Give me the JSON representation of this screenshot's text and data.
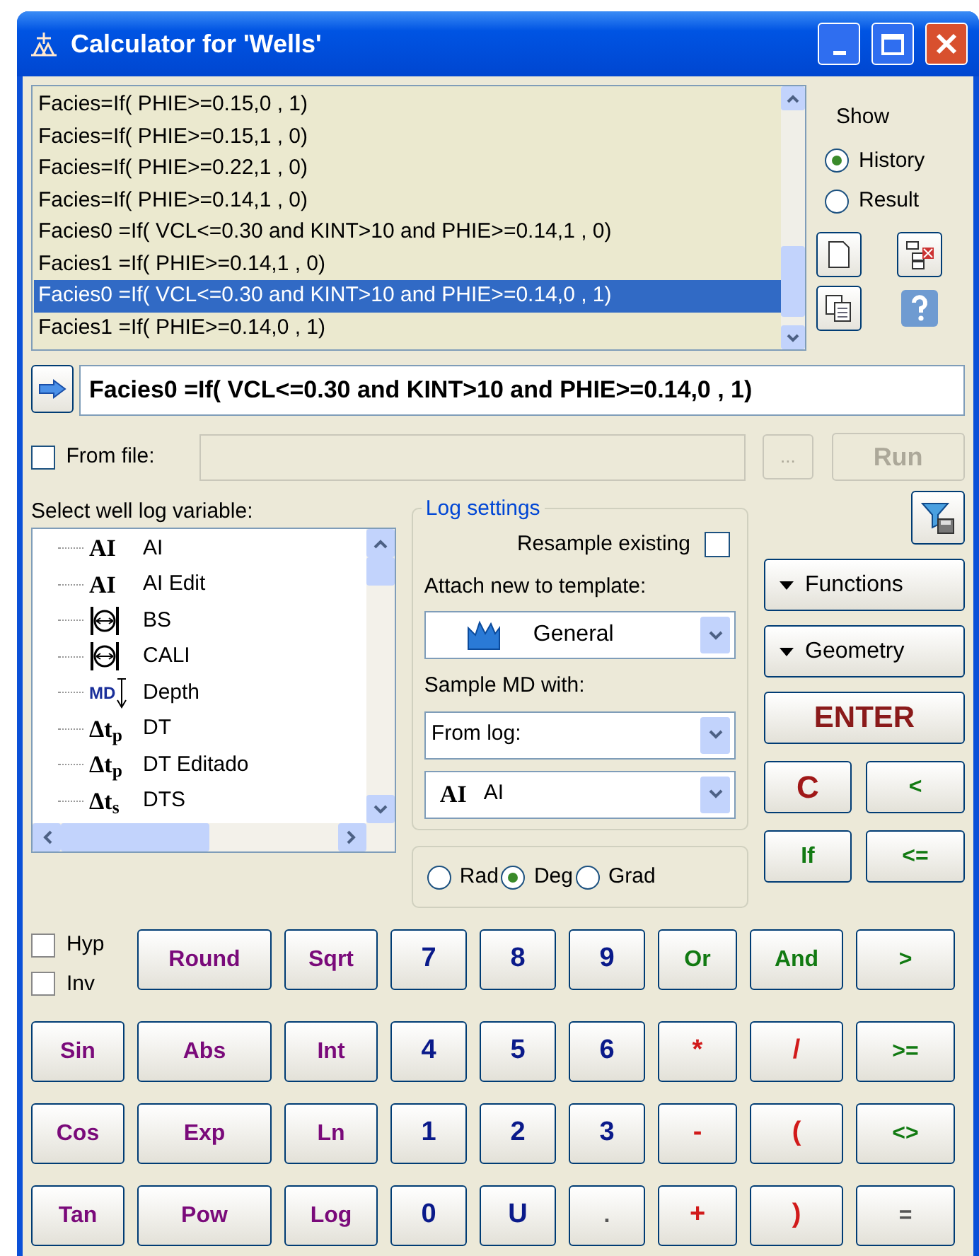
{
  "window": {
    "title": "Calculator for 'Wells'"
  },
  "history": [
    {
      "text": "Facies=If( PHIE>=0.15,0 , 1)",
      "selected": false
    },
    {
      "text": "Facies=If( PHIE>=0.15,1 , 0)",
      "selected": false
    },
    {
      "text": "Facies=If( PHIE>=0.22,1 , 0)",
      "selected": false
    },
    {
      "text": "Facies=If( PHIE>=0.14,1 , 0)",
      "selected": false
    },
    {
      "text": "Facies0 =If( VCL<=0.30 and KINT>10 and PHIE>=0.14,1 , 0)",
      "selected": false
    },
    {
      "text": "Facies1 =If( PHIE>=0.14,1 , 0)",
      "selected": false
    },
    {
      "text": "Facies0 =If( VCL<=0.30 and KINT>10 and PHIE>=0.14,0 , 1)",
      "selected": true
    },
    {
      "text": "Facies1 =If( PHIE>=0.14,0 , 1)",
      "selected": false
    }
  ],
  "show": {
    "label": "Show",
    "options": [
      {
        "label": "History",
        "selected": true
      },
      {
        "label": "Result",
        "selected": false
      }
    ]
  },
  "formula": {
    "value": "Facies0 =If( VCL<=0.30 and KINT>10 and PHIE>=0.14,0 , 1)"
  },
  "from_file": {
    "label": "From file:",
    "checked": false,
    "browse": "...",
    "run": "Run",
    "run_disabled": true
  },
  "variables": {
    "label": "Select well log variable:",
    "items": [
      {
        "kind": "text",
        "symbol": "AI",
        "name": "AI"
      },
      {
        "kind": "text",
        "symbol": "AI",
        "name": "AI Edit"
      },
      {
        "kind": "caliper",
        "name": "BS"
      },
      {
        "kind": "caliper",
        "name": "CALI"
      },
      {
        "kind": "depth",
        "symbol": "MD",
        "name": "Depth"
      },
      {
        "kind": "text",
        "symbol": "Δt$_{p}$",
        "name": "DT"
      },
      {
        "kind": "text",
        "symbol": "Δt$_{p}$",
        "name": "DT Editado"
      },
      {
        "kind": "text",
        "symbol": "Δt$_{s}$",
        "name": "DTS"
      }
    ]
  },
  "log_settings": {
    "title": "Log settings",
    "resample": {
      "label": "Resample existing",
      "checked": false
    },
    "attach_label": "Attach new to template:",
    "template": "General",
    "sample_label": "Sample MD with:",
    "sample_with": "From log:",
    "log": {
      "symbol": "AI",
      "value": "AI"
    }
  },
  "angle_units": [
    {
      "label": "Rad",
      "selected": false
    },
    {
      "label": "Deg",
      "selected": true
    },
    {
      "label": "Grad",
      "selected": false
    }
  ],
  "side_buttons": [
    {
      "label": "Functions",
      "kind": "menu"
    },
    {
      "label": "Geometry",
      "kind": "menu"
    },
    {
      "label": "ENTER",
      "kind": "enter"
    }
  ],
  "side_pairs": [
    [
      {
        "label": "C",
        "kind": "clear"
      },
      {
        "label": "<",
        "kind": "logic"
      }
    ],
    [
      {
        "label": "If",
        "kind": "logic"
      },
      {
        "label": "<=",
        "kind": "logic"
      }
    ]
  ],
  "modifiers": [
    {
      "label": "Hyp",
      "checked": false
    },
    {
      "label": "Inv",
      "checked": false
    }
  ],
  "keypad": [
    [
      {
        "label": "Round",
        "kind": "function"
      },
      {
        "label": "Sqrt",
        "kind": "function"
      },
      {
        "label": "7",
        "kind": "digit"
      },
      {
        "label": "8",
        "kind": "digit"
      },
      {
        "label": "9",
        "kind": "digit"
      },
      {
        "label": "Or",
        "kind": "logic"
      },
      {
        "label": "And",
        "kind": "logic"
      },
      {
        "label": ">",
        "kind": "logic"
      }
    ],
    [
      {
        "label": "Sin",
        "kind": "function"
      },
      {
        "label": "Abs",
        "kind": "function"
      },
      {
        "label": "Int",
        "kind": "function"
      },
      {
        "label": "4",
        "kind": "digit"
      },
      {
        "label": "5",
        "kind": "digit"
      },
      {
        "label": "6",
        "kind": "digit"
      },
      {
        "label": "*",
        "kind": "operator"
      },
      {
        "label": "/",
        "kind": "operator"
      },
      {
        "label": ">=",
        "kind": "logic"
      }
    ],
    [
      {
        "label": "Cos",
        "kind": "function"
      },
      {
        "label": "Exp",
        "kind": "function"
      },
      {
        "label": "Ln",
        "kind": "function"
      },
      {
        "label": "1",
        "kind": "digit"
      },
      {
        "label": "2",
        "kind": "digit"
      },
      {
        "label": "3",
        "kind": "digit"
      },
      {
        "label": "-",
        "kind": "operator"
      },
      {
        "label": "(",
        "kind": "operator"
      },
      {
        "label": "<>",
        "kind": "logic"
      }
    ],
    [
      {
        "label": "Tan",
        "kind": "function"
      },
      {
        "label": "Pow",
        "kind": "function"
      },
      {
        "label": "Log",
        "kind": "function"
      },
      {
        "label": "0",
        "kind": "digit"
      },
      {
        "label": "U",
        "kind": "digit"
      },
      {
        "label": ".",
        "kind": "plain"
      },
      {
        "label": "+",
        "kind": "operator"
      },
      {
        "label": ")",
        "kind": "operator"
      },
      {
        "label": "=",
        "kind": "plain"
      }
    ]
  ]
}
